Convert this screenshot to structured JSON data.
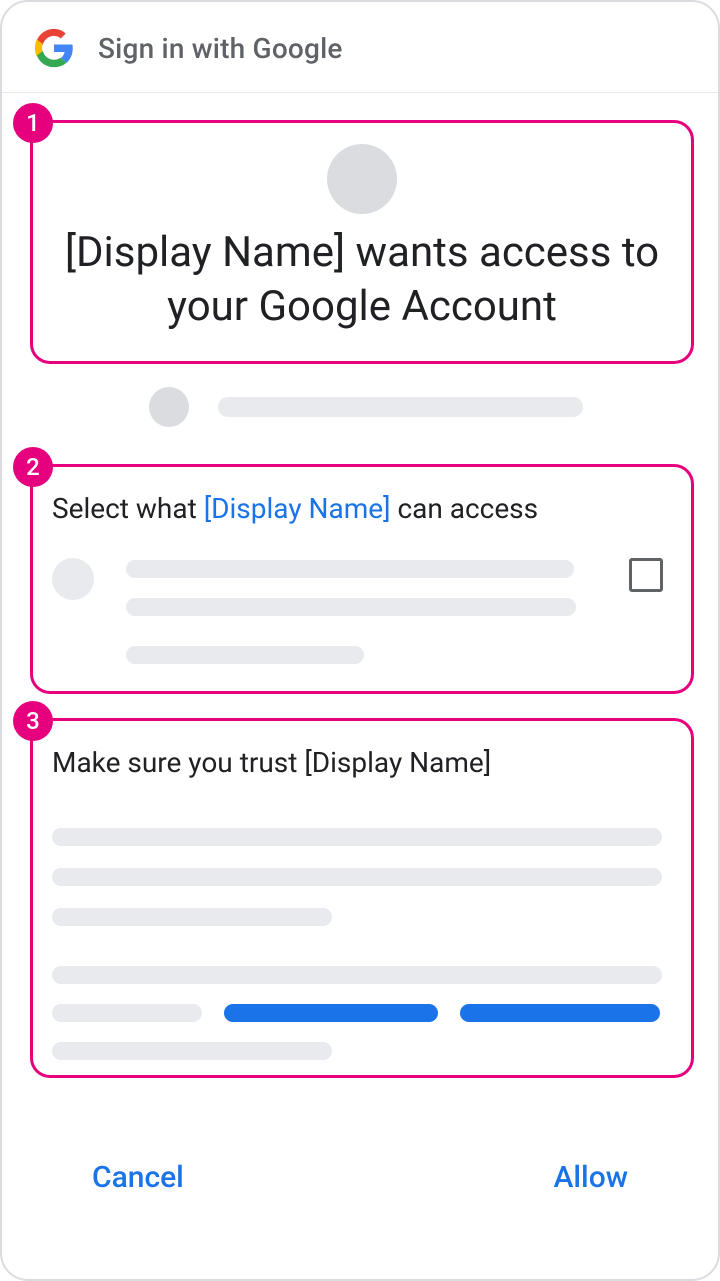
{
  "header": {
    "title": "Sign in with Google"
  },
  "annotations": {
    "n1": "1",
    "n2": "2",
    "n3": "3"
  },
  "section1": {
    "headline": "[Display Name] wants access to your Google Account"
  },
  "section2": {
    "title_prefix": "Select what ",
    "title_link": "[Display Name]",
    "title_suffix": " can access"
  },
  "section3": {
    "title": "Make sure you trust [Display Name]"
  },
  "footer": {
    "cancel": "Cancel",
    "allow": "Allow"
  },
  "colors": {
    "accent": "#1a73e8",
    "annotation": "#e6007e"
  }
}
